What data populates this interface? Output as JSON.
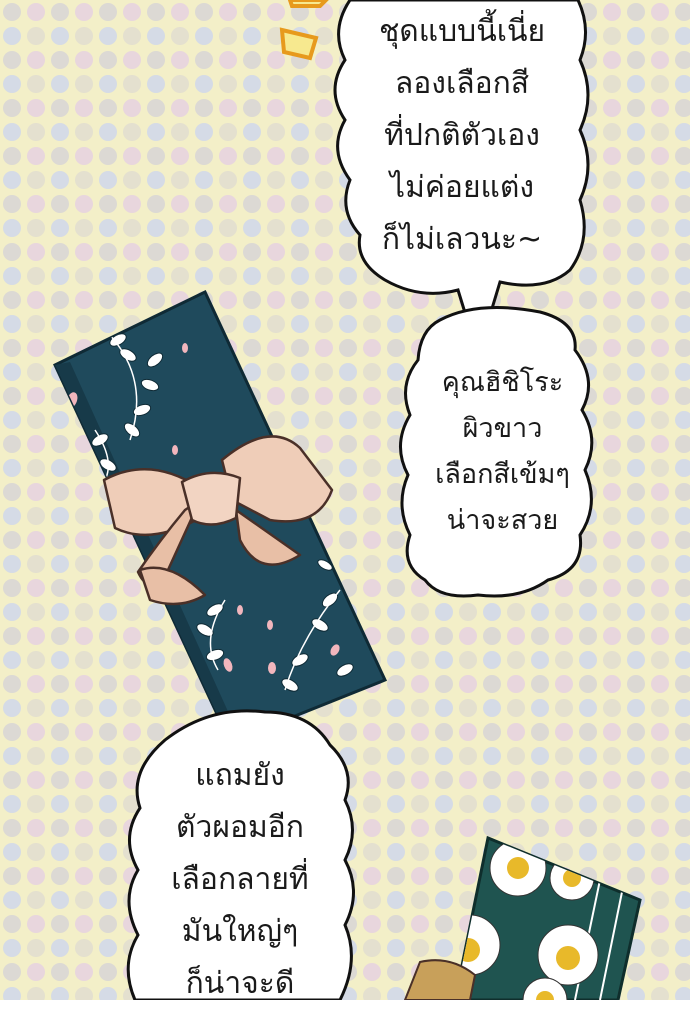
{
  "panel": {
    "background": "#f3efc8",
    "dot_colors": [
      "#dcd9d4",
      "#e8d6dd",
      "#d5dbe6",
      "#ece4c6"
    ]
  },
  "bubbles": [
    {
      "id": "top",
      "lines": [
        "ชุดแบบนี้เนี่ย",
        "ลองเลือกสี",
        "ที่ปกติตัวเอง",
        "ไม่ค่อยแต่ง",
        "ก็ไม่เลวนะ~"
      ]
    },
    {
      "id": "middle",
      "lines": [
        "คุณฮิชิโระ",
        "ผิวขาว",
        "เลือกสีเข้มๆ",
        "น่าจะสวย"
      ]
    },
    {
      "id": "bottom",
      "lines": [
        "แถมยัง",
        "ตัวผอมอีก",
        "เลือกลายที่",
        "มันใหญ่ๆ",
        "ก็น่าจะดี"
      ]
    }
  ],
  "items": {
    "navy_kimono": {
      "fabric": "#1f4a5c",
      "bow": "#efcdb8",
      "pattern": "leaf-and-petal"
    },
    "daisy_kimono": {
      "fabric": "#1f5450",
      "flower": "#ffffff",
      "flower_center": "#e8b92a",
      "pattern": "daisy"
    }
  },
  "accent": {
    "sfx_color": "#f0b429"
  }
}
